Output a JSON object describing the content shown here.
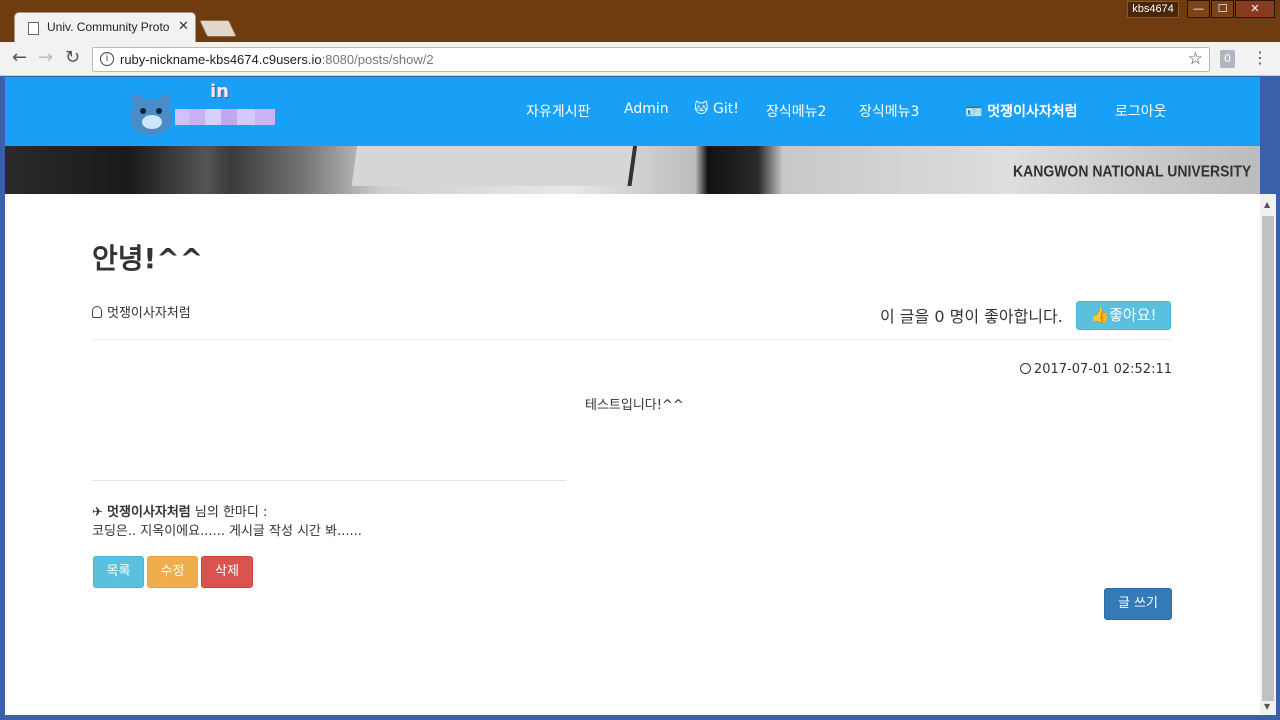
{
  "window": {
    "user_badge": "kbs4674",
    "minimize": "—",
    "maximize": "☐",
    "close": "✕"
  },
  "tab": {
    "title": "Univ. Community Proto",
    "close": "✕"
  },
  "toolbar": {
    "back": "←",
    "forward": "→",
    "reload": "↻",
    "url_host": "ruby-nickname-kbs4674.c9users.io",
    "url_rest": ":8080/posts/show/2",
    "info": "i",
    "star": "☆",
    "ext": "0",
    "menu": "⋮"
  },
  "navbar": {
    "logo_text": "in",
    "links": [
      "자유게시판",
      "Admin",
      "🐱 Git!",
      "장식메뉴2",
      "장식메뉴3",
      "🪪 멋쟁이사자처럼",
      "로그아웃"
    ]
  },
  "banner": {
    "text": "KANGWON NATIONAL UNIVERSITY"
  },
  "post": {
    "title": "안녕!^^",
    "author": "멋쟁이사자처럼",
    "likes_text": "이 글을 0 명이 좋아합니다.",
    "like_button": "👍좋아요!",
    "date": "2017-07-01 02:52:11",
    "body": "테스트입니다!^^"
  },
  "signature": {
    "name": "멋쟁이사자처럼",
    "suffix": " 님의 한마디 :",
    "message": "코딩은.. 지옥이에요...... 게시글 작성 시간 봐......"
  },
  "buttons": {
    "list": "목록",
    "edit": "수정",
    "delete": "삭제",
    "write": "글 쓰기"
  },
  "colors": {
    "navbar": "#18a0f6",
    "titlebar": "#6e3c0f",
    "btn_info": "#5bc0de",
    "btn_warning": "#f0ad4e",
    "btn_danger": "#d9534f",
    "btn_primary": "#337ab7"
  }
}
